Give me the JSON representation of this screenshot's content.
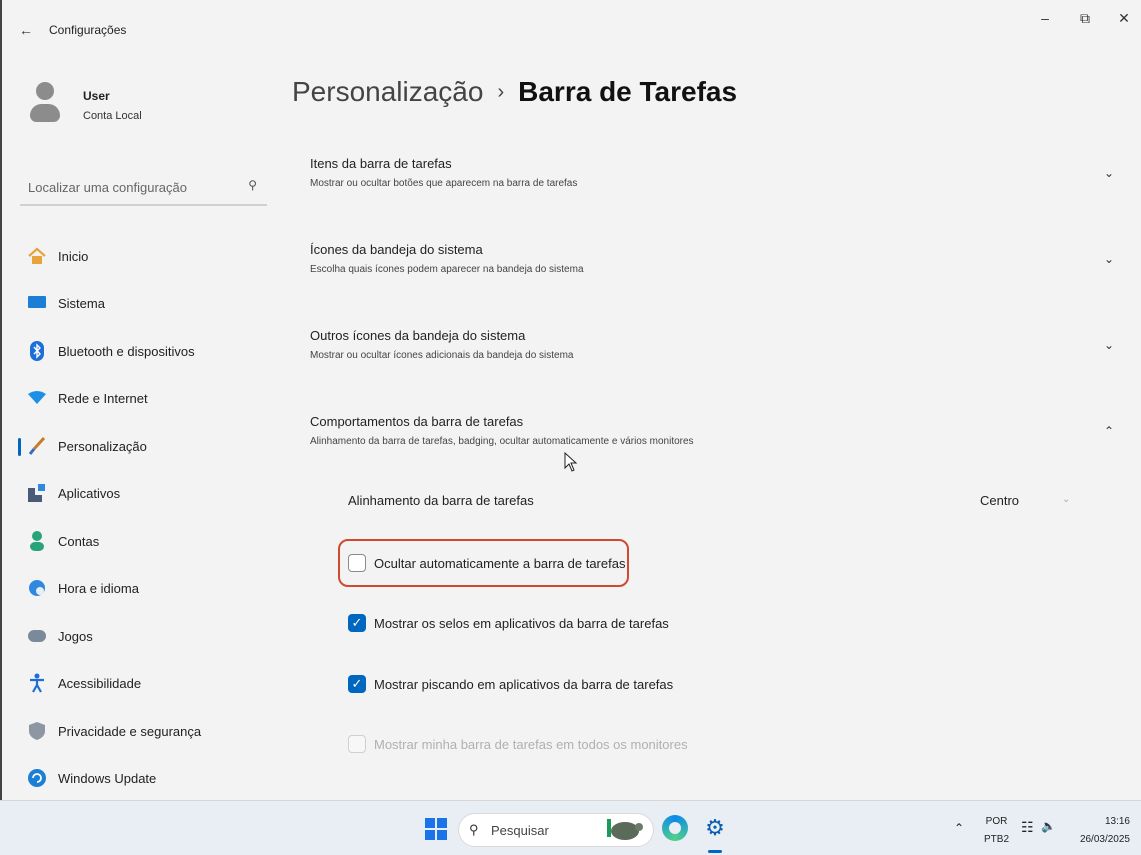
{
  "window": {
    "title": "Configurações",
    "back_icon": "arrow-left-icon",
    "minimize": "–",
    "maximize": "⧉",
    "close": "✕"
  },
  "user": {
    "name": "User",
    "account": "Conta Local"
  },
  "search": {
    "placeholder": "Localizar uma configuração"
  },
  "nav": {
    "items": [
      {
        "label": "Inicio",
        "icon": "home-icon"
      },
      {
        "label": "Sistema",
        "icon": "monitor-icon"
      },
      {
        "label": "Bluetooth e dispositivos",
        "icon": "bluetooth-icon"
      },
      {
        "label": "Rede e Internet",
        "icon": "wifi-icon"
      },
      {
        "label": "Personalização",
        "icon": "brush-icon",
        "active": true
      },
      {
        "label": "Aplicativos",
        "icon": "apps-icon"
      },
      {
        "label": "Contas",
        "icon": "person-icon"
      },
      {
        "label": "Hora e idioma",
        "icon": "globe-clock-icon"
      },
      {
        "label": "Jogos",
        "icon": "gamepad-icon"
      },
      {
        "label": "Acessibilidade",
        "icon": "accessibility-icon"
      },
      {
        "label": "Privacidade e segurança",
        "icon": "shield-icon"
      },
      {
        "label": "Windows Update",
        "icon": "update-icon"
      }
    ]
  },
  "breadcrumb": {
    "parent": "Personalização",
    "separator": "›",
    "current": "Barra de Tarefas"
  },
  "sections": [
    {
      "title": "Itens da barra de tarefas",
      "description": "Mostrar ou ocultar botões que aparecem na barra de tarefas",
      "expanded": false
    },
    {
      "title": "Ícones da bandeja do sistema",
      "description": "Escolha quais ícones podem aparecer na bandeja do sistema",
      "expanded": false
    },
    {
      "title": "Outros ícones da bandeja do sistema",
      "description": "Mostrar ou ocultar ícones adicionais da bandeja do sistema",
      "expanded": false
    },
    {
      "title": "Comportamentos da barra de tarefas",
      "description": "Alinhamento da barra de tarefas, badging, ocultar automaticamente e vários monitores",
      "expanded": true
    }
  ],
  "behaviors": {
    "alignment_label": "Alinhamento da barra de tarefas",
    "alignment_value": "Centro",
    "options": [
      {
        "label": "Ocultar automaticamente a barra de tarefas",
        "checked": false,
        "enabled": true
      },
      {
        "label": "Mostrar os selos em aplicativos da barra de tarefas",
        "checked": true,
        "enabled": true
      },
      {
        "label": "Mostrar piscando em aplicativos da barra de tarefas",
        "checked": true,
        "enabled": true
      },
      {
        "label": "Mostrar minha barra de tarefas em todos os monitores",
        "checked": false,
        "enabled": false
      }
    ]
  },
  "taskbar": {
    "search_placeholder": "Pesquisar",
    "lang_line1": "POR",
    "lang_line2": "PTB2",
    "time": "13:16",
    "date": "26/03/2025",
    "accent": "#0067c0"
  }
}
